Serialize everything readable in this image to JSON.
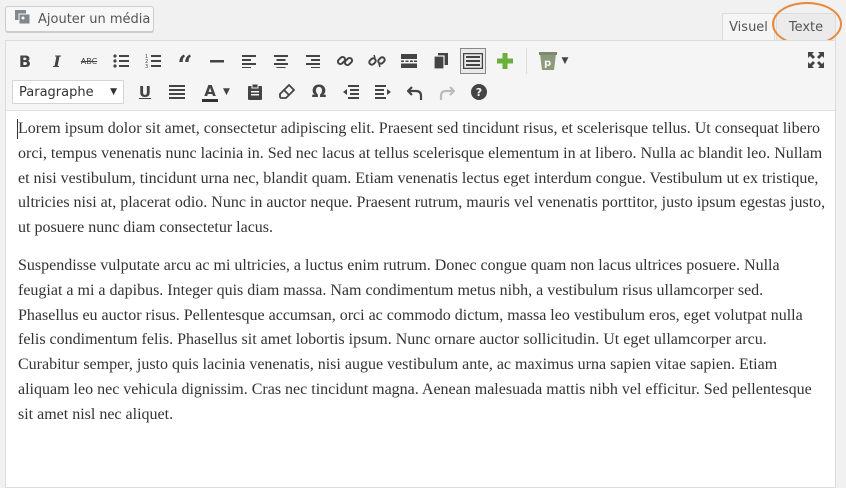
{
  "add_media": {
    "label": "Ajouter un média"
  },
  "tabs": {
    "visual": "Visuel",
    "text": "Texte"
  },
  "toolbar": {
    "format_select": "Paragraphe",
    "row1_icons": [
      "bold",
      "italic",
      "strikethrough",
      "bullet-list",
      "numbered-list",
      "blockquote",
      "horizontal-line",
      "align-left",
      "align-center",
      "align-right",
      "link",
      "unlink",
      "read-more",
      "paste-word",
      "toolbar-toggle",
      "add",
      "plugin"
    ],
    "row2_icons": [
      "underline",
      "justify",
      "text-color",
      "paste-text",
      "clear-formatting",
      "special-character",
      "outdent",
      "indent",
      "undo",
      "redo",
      "help"
    ],
    "bold": "B",
    "italic": "I",
    "strike": "ABC",
    "underline": "U",
    "text_color_letter": "A",
    "omega": "Ω",
    "help": "?"
  },
  "colors": {
    "highlight": "#e8883a",
    "add_green": "#6bb03c",
    "text_color_bar": "#333333"
  },
  "content": {
    "paragraphs": [
      "Lorem ipsum dolor sit amet, consectetur adipiscing elit. Praesent sed tincidunt risus, et scelerisque tellus. Ut consequat libero orci, tempus venenatis nunc lacinia in. Sed nec lacus at tellus scelerisque elementum in at libero. Nulla ac blandit leo. Nullam et nisi vestibulum, tincidunt urna nec, blandit quam. Etiam venenatis lectus eget interdum congue. Vestibulum ut ex tristique, ultricies nisi at, placerat odio. Nunc in auctor neque. Praesent rutrum, mauris vel venenatis porttitor, justo ipsum egestas justo, ut posuere nunc diam consectetur lacus.",
      "Suspendisse vulputate arcu ac mi ultricies, a luctus enim rutrum. Donec congue quam non lacus ultrices posuere. Nulla feugiat a mi a dapibus. Integer quis diam massa. Nam condimentum metus nibh, a vestibulum risus ullamcorper sed. Phasellus eu auctor risus. Pellentesque accumsan, orci ac commodo dictum, massa leo vestibulum eros, eget volutpat nulla felis condimentum felis. Phasellus sit amet lobortis ipsum. Nunc ornare auctor sollicitudin. Ut eget ullamcorper arcu. Curabitur semper, justo quis lacinia venenatis, nisi augue vestibulum ante, ac maximus urna sapien vitae sapien. Etiam aliquam leo nec vehicula dignissim. Cras nec tincidunt magna. Aenean malesuada mattis nibh vel efficitur. Sed pellentesque sit amet nisl nec aliquet."
    ]
  }
}
